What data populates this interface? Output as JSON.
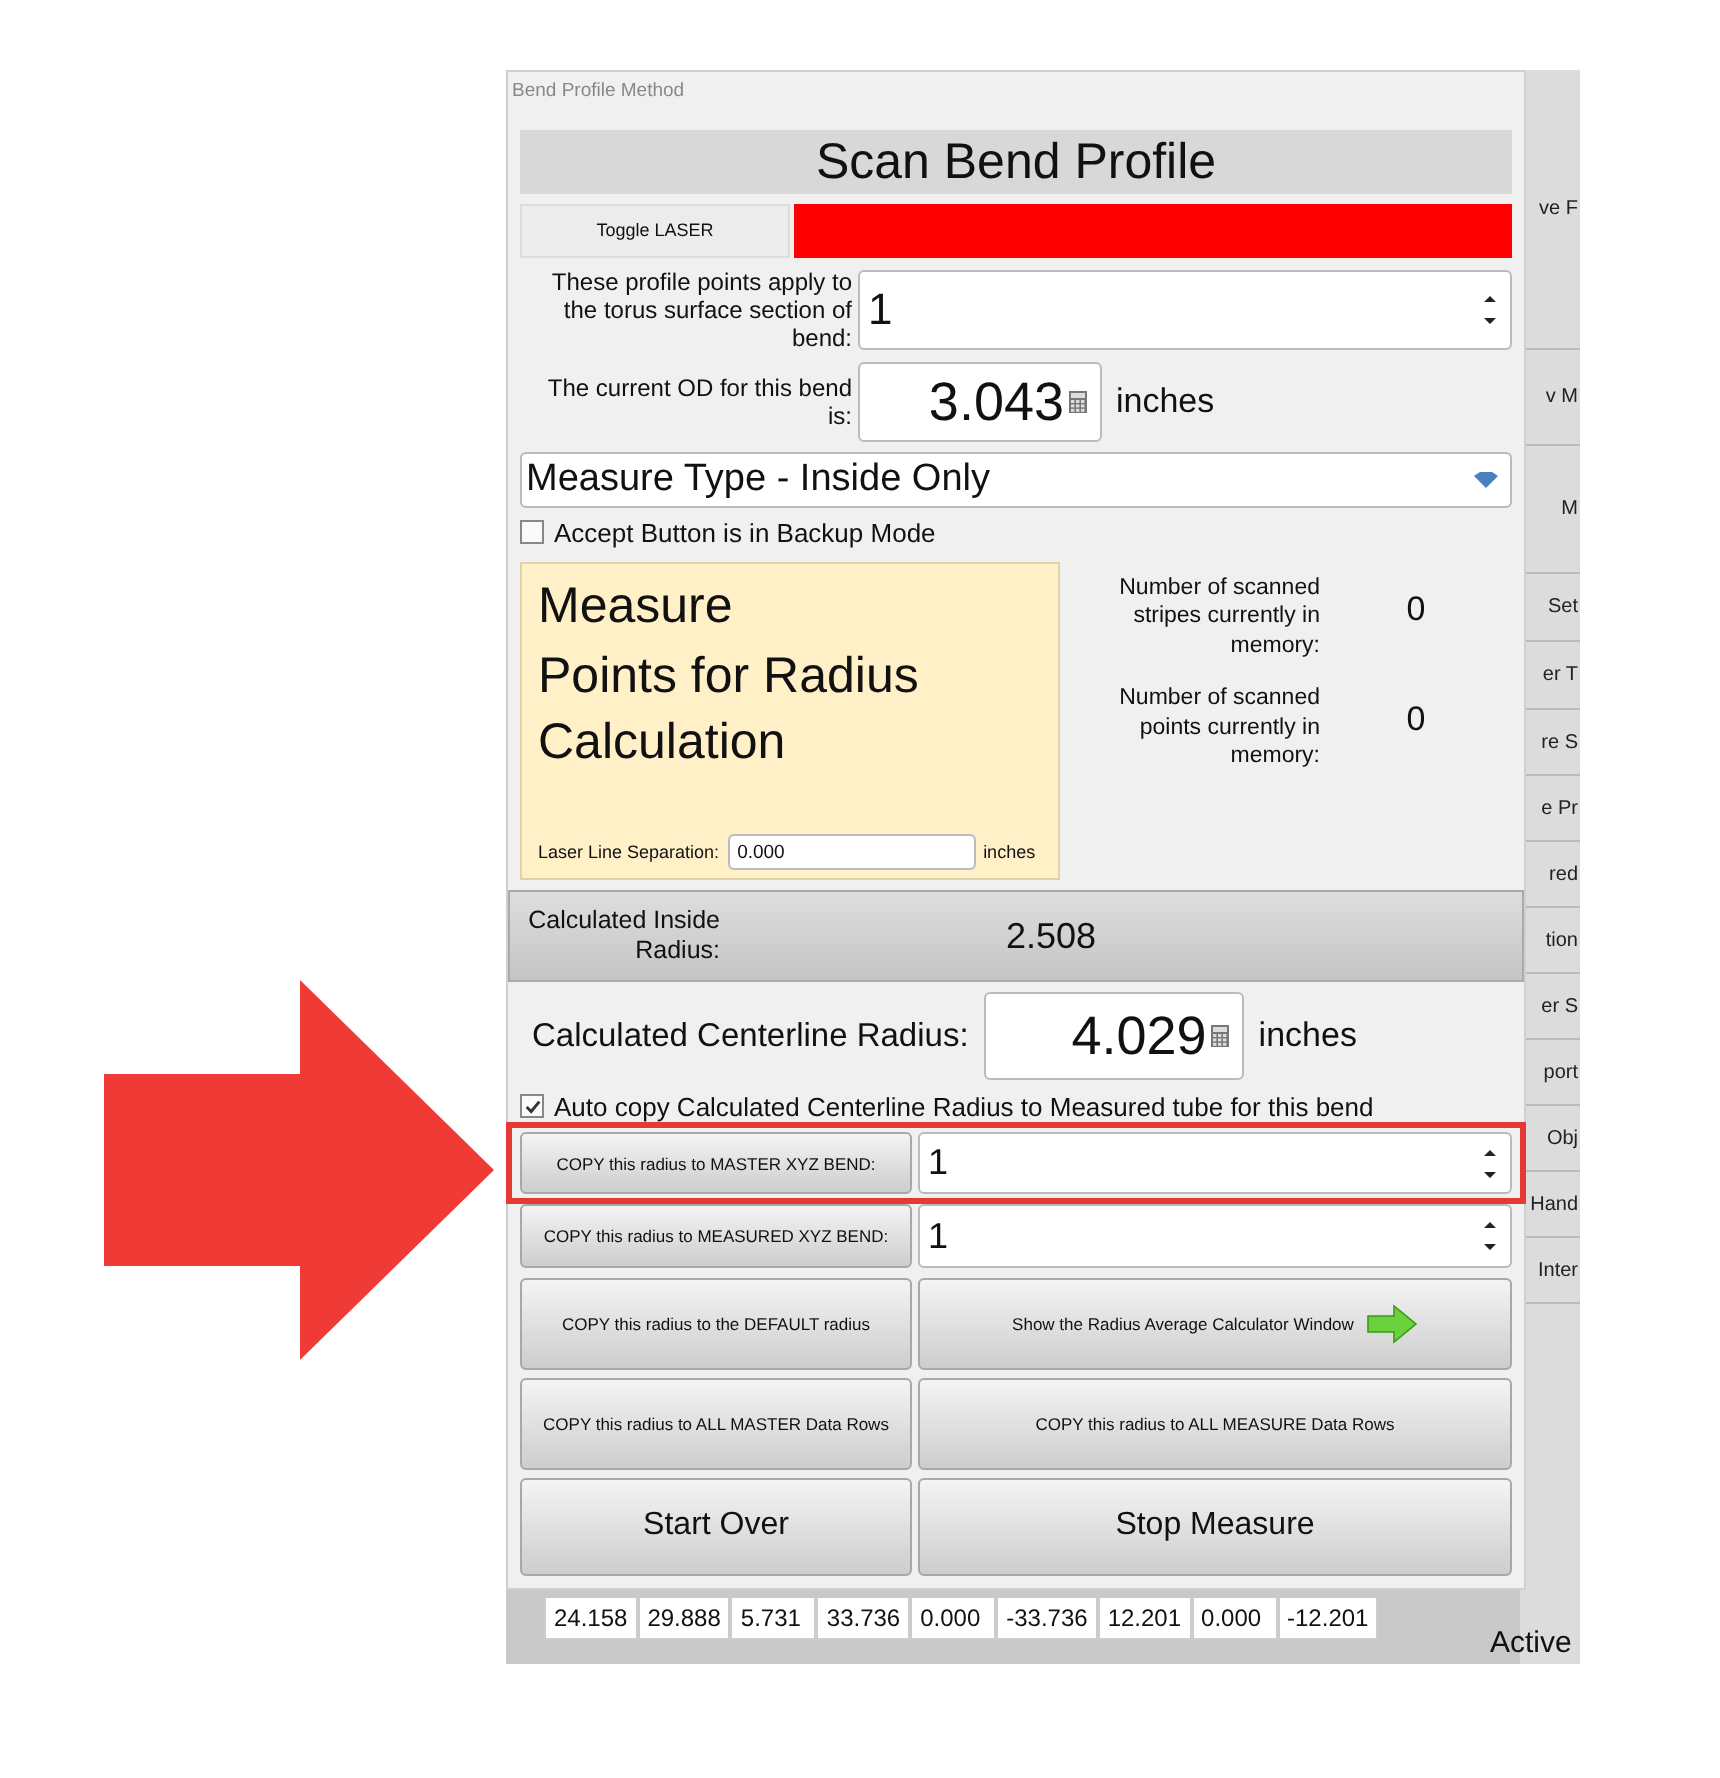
{
  "window": {
    "title": "Bend Profile Method"
  },
  "header": "Scan Bend Profile",
  "laser": {
    "button": "Toggle LASER",
    "on": true
  },
  "torus_section": {
    "label": "These profile points apply to the torus surface section of bend:",
    "value": "1"
  },
  "current_od": {
    "label": "The current OD for this bend is:",
    "value": "3.043",
    "unit": "inches"
  },
  "measure_type": {
    "value": "Measure Type - Inside Only"
  },
  "backup_mode": {
    "label": "Accept Button is in Backup Mode",
    "checked": false
  },
  "instruction_panel": {
    "heading_lines": [
      "Measure",
      "Points for Radius Calculation"
    ],
    "separation_label": "Laser Line Separation:",
    "separation_value": "0.000",
    "separation_unit": "inches"
  },
  "counters": [
    {
      "label": "Number of scanned stripes currently in memory:",
      "value": "0"
    },
    {
      "label": "Number of scanned points currently in memory:",
      "value": "0"
    }
  ],
  "inside_radius": {
    "label": "Calculated Inside Radius:",
    "value": "2.508"
  },
  "centerline_radius": {
    "label": "Calculated Centerline Radius:",
    "value": "4.029",
    "unit": "inches"
  },
  "auto_copy": {
    "label": "Auto copy Calculated Centerline Radius to Measured tube for this bend",
    "checked": true
  },
  "copy_rows": [
    {
      "button": "COPY this radius to MASTER XYZ BEND:",
      "value": "1",
      "highlighted": true
    },
    {
      "button": "COPY this radius to MEASURED XYZ BEND:",
      "value": "1",
      "highlighted": false
    }
  ],
  "action_buttons": [
    {
      "label": "COPY this radius to the DEFAULT radius",
      "kind": "small"
    },
    {
      "label": "Show the Radius Average Calculator Window",
      "kind": "arrow"
    },
    {
      "label": "COPY this radius to ALL MASTER Data Rows",
      "kind": "small"
    },
    {
      "label": "COPY this radius to ALL MEASURE Data Rows",
      "kind": "small"
    },
    {
      "label": "Start Over",
      "kind": "large"
    },
    {
      "label": "Stop Measure",
      "kind": "large"
    }
  ],
  "background_window": {
    "side_labels": [
      "ve F",
      "v M",
      "M",
      "Set",
      "er T",
      "re S",
      "e Pr",
      "red",
      "tion",
      "er S",
      "port",
      "Obj",
      "Hand",
      "Inter"
    ],
    "table_row": [
      "24.158",
      "29.888",
      "5.731",
      "33.736",
      "0.000",
      "-33.736",
      "12.201",
      "0.000",
      "-12.201"
    ],
    "status": "Active"
  }
}
